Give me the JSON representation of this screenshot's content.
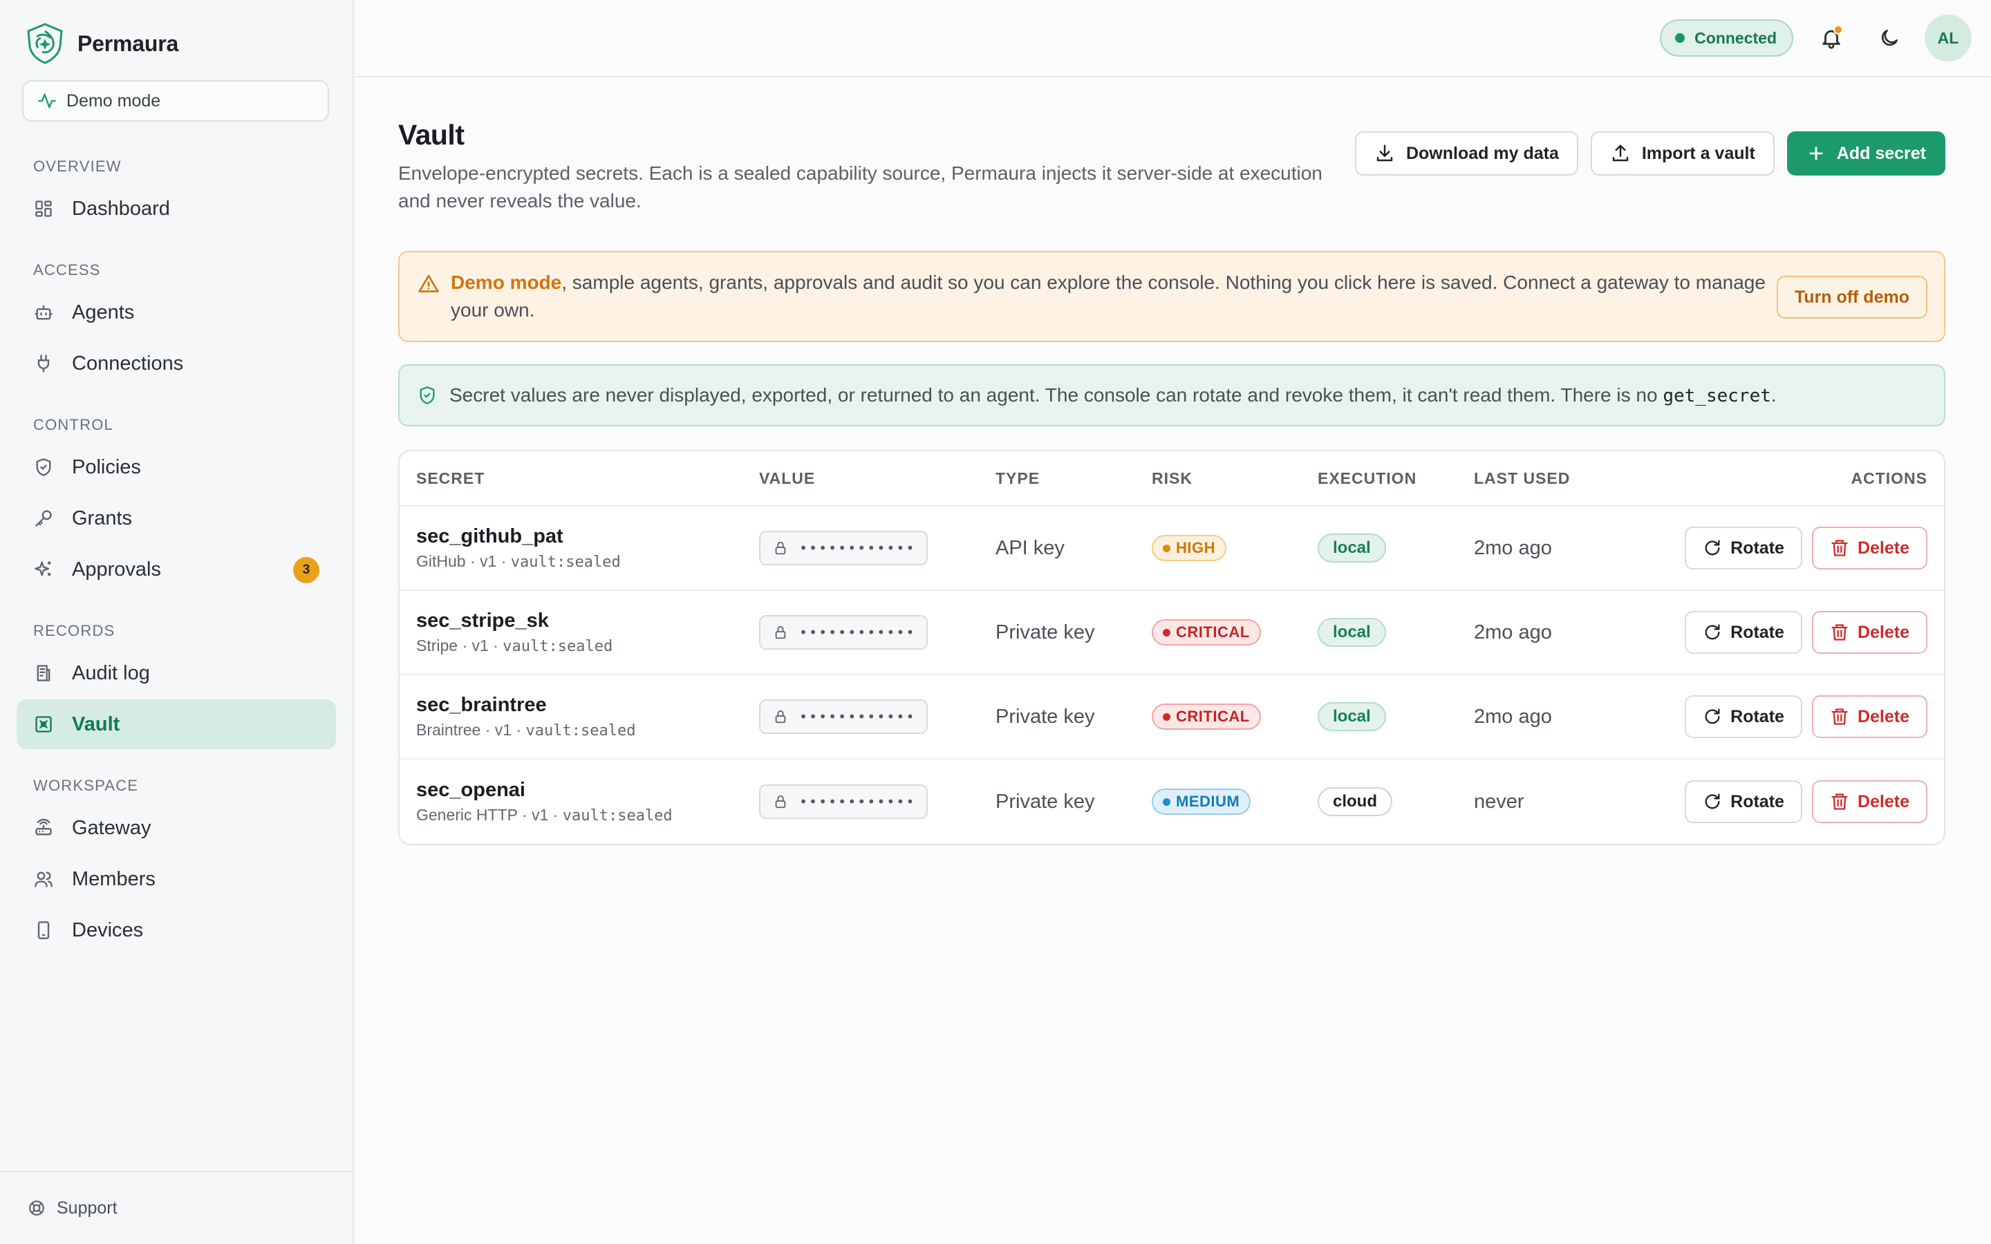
{
  "app": {
    "name": "Permaura",
    "demo_pill": "Demo mode",
    "support": "Support"
  },
  "sidebar": {
    "sections": [
      {
        "heading": "OVERVIEW",
        "items": [
          {
            "label": "Dashboard",
            "icon": "dashboard-icon"
          }
        ]
      },
      {
        "heading": "ACCESS",
        "items": [
          {
            "label": "Agents",
            "icon": "bot-icon"
          },
          {
            "label": "Connections",
            "icon": "plug-icon"
          }
        ]
      },
      {
        "heading": "CONTROL",
        "items": [
          {
            "label": "Policies",
            "icon": "shield-icon"
          },
          {
            "label": "Grants",
            "icon": "key-icon"
          },
          {
            "label": "Approvals",
            "icon": "sparkle-icon",
            "badge": "3"
          }
        ]
      },
      {
        "heading": "RECORDS",
        "items": [
          {
            "label": "Audit log",
            "icon": "audit-log-icon"
          },
          {
            "label": "Vault",
            "icon": "vault-icon",
            "active": true
          }
        ]
      },
      {
        "heading": "WORKSPACE",
        "items": [
          {
            "label": "Gateway",
            "icon": "router-icon"
          },
          {
            "label": "Members",
            "icon": "users-icon"
          },
          {
            "label": "Devices",
            "icon": "device-icon"
          }
        ]
      }
    ]
  },
  "topbar": {
    "status": "Connected",
    "avatar_initials": "AL"
  },
  "page": {
    "title": "Vault",
    "subtitle": "Envelope-encrypted secrets. Each is a sealed capability source, Permaura injects it server-side at execution and never reveals the value.",
    "actions": {
      "download": "Download my data",
      "import": "Import a vault",
      "add": "Add secret"
    }
  },
  "demo_banner": {
    "highlight": "Demo mode",
    "text": ", sample agents, grants, approvals and audit so you can explore the console. Nothing you click here is saved. Connect a gateway to manage your own.",
    "button": "Turn off demo"
  },
  "info_banner": {
    "text": "Secret values are never displayed, exported, or returned to an agent. The console can rotate and revoke them, it can't read them. There is no ",
    "code": "get_secret",
    "suffix": "."
  },
  "table": {
    "headers": {
      "secret": "SECRET",
      "value": "VALUE",
      "type": "TYPE",
      "risk": "RISK",
      "execution": "EXECUTION",
      "last_used": "LAST USED",
      "actions": "ACTIONS"
    },
    "masked": "••••••••••••",
    "rotate_label": "Rotate",
    "delete_label": "Delete",
    "rows": [
      {
        "name": "sec_github_pat",
        "provider": "GitHub · v1 · ",
        "sealed": "vault:sealed",
        "type": "API key",
        "risk": "HIGH",
        "risk_level": "high",
        "execution": "local",
        "last_used": "2mo ago"
      },
      {
        "name": "sec_stripe_sk",
        "provider": "Stripe · v1 · ",
        "sealed": "vault:sealed",
        "type": "Private key",
        "risk": "CRITICAL",
        "risk_level": "critical",
        "execution": "local",
        "last_used": "2mo ago"
      },
      {
        "name": "sec_braintree",
        "provider": "Braintree · v1 · ",
        "sealed": "vault:sealed",
        "type": "Private key",
        "risk": "CRITICAL",
        "risk_level": "critical",
        "execution": "local",
        "last_used": "2mo ago"
      },
      {
        "name": "sec_openai",
        "provider": "Generic HTTP · v1 · ",
        "sealed": "vault:sealed",
        "type": "Private key",
        "risk": "MEDIUM",
        "risk_level": "medium",
        "execution": "cloud",
        "last_used": "never"
      }
    ]
  },
  "colors": {
    "accent": "#1d9a6c",
    "warning": "#d3740b",
    "danger": "#cc2b2b"
  }
}
